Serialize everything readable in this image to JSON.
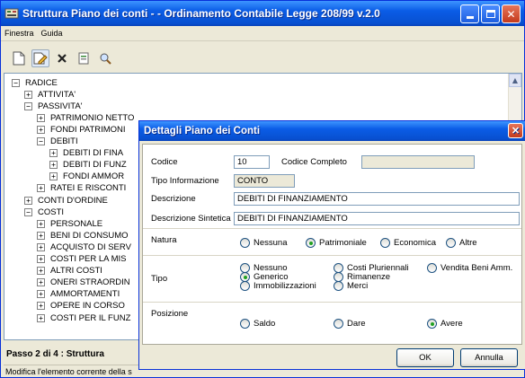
{
  "window": {
    "title": "Struttura Piano dei conti -  - Ordinamento Contabile Legge 208/99 v.2.0"
  },
  "menu": [
    "Finestra",
    "Guida"
  ],
  "toolbar": {
    "icons": [
      "new-document-icon",
      "edit-icon",
      "delete-icon",
      "properties-icon",
      "search-icon"
    ]
  },
  "tree": {
    "rows": [
      {
        "sign": "⊟",
        "label": "RADICE"
      },
      {
        "sign": "⊞",
        "label": "ATTIVITA'"
      },
      {
        "sign": "⊟",
        "label": "PASSIVITA'"
      },
      {
        "sign": "⊞",
        "label": "PATRIMONIO NETTO"
      },
      {
        "sign": "⊞",
        "label": "FONDI PATRIMONI"
      },
      {
        "sign": "⊟",
        "label": "DEBITI"
      },
      {
        "sign": "⊞",
        "label": "DEBITI DI FINA"
      },
      {
        "sign": "⊞",
        "label": "DEBITI DI FUNZ"
      },
      {
        "sign": "⊞",
        "label": "FONDI AMMOR"
      },
      {
        "sign": "⊞",
        "label": "RATEI E RISCONTI"
      },
      {
        "sign": "⊞",
        "label": "CONTI D'ORDINE"
      },
      {
        "sign": "⊟",
        "label": "COSTI"
      },
      {
        "sign": "⊞",
        "label": "PERSONALE"
      },
      {
        "sign": "⊞",
        "label": "BENI DI CONSUMO"
      },
      {
        "sign": "⊞",
        "label": "ACQUISTO DI SERV"
      },
      {
        "sign": "⊞",
        "label": "COSTI PER LA MIS"
      },
      {
        "sign": "⊞",
        "label": "ALTRI COSTI"
      },
      {
        "sign": "⊞",
        "label": "ONERI STRAORDIN"
      },
      {
        "sign": "⊞",
        "label": "AMMORTAMENTI"
      },
      {
        "sign": "⊞",
        "label": "OPERE IN CORSO"
      },
      {
        "sign": "⊞",
        "label": "COSTI PER IL FUNZ"
      }
    ]
  },
  "footer": {
    "step": "Passo 2 di 4  : Struttura",
    "status": "Modifica l'elemento corrente della s"
  },
  "dialog": {
    "title": "Dettagli Piano dei Conti",
    "codice_label": "Codice",
    "codice_value": "10",
    "codice_completo_label": "Codice Completo",
    "codice_completo_value": "",
    "tipo_info_label": "Tipo Informazione",
    "tipo_info_value": "CONTO",
    "descrizione_label": "Descrizione",
    "descrizione_value": "DEBITI DI FINANZIAMENTO",
    "desc_sint_label": "Descrizione Sintetica",
    "desc_sint_value": "DEBITI DI FINANZIAMENTO",
    "natura_label": "Natura",
    "natura_options": [
      {
        "label": "Nessuna",
        "checked": false
      },
      {
        "label": "Patrimoniale",
        "checked": true
      },
      {
        "label": "Economica",
        "checked": false
      },
      {
        "label": "Altre",
        "checked": false
      }
    ],
    "tipo_label": "Tipo",
    "tipo_options": [
      {
        "label": "Nessuno",
        "checked": false
      },
      {
        "label": "Generico",
        "checked": true
      },
      {
        "label": "Immobilizzazioni",
        "checked": false
      },
      {
        "label": "Costi Pluriennali",
        "checked": false
      },
      {
        "label": "Rimanenze",
        "checked": false
      },
      {
        "label": "Merci",
        "checked": false
      },
      {
        "label": "Vendita Beni Amm.",
        "checked": false
      }
    ],
    "posizione_label": "Posizione",
    "posizione_options": [
      {
        "label": "Saldo",
        "checked": false
      },
      {
        "label": "Dare",
        "checked": false
      },
      {
        "label": "Avere",
        "checked": true
      }
    ],
    "ok_label": "OK",
    "cancel_label": "Annulla"
  }
}
